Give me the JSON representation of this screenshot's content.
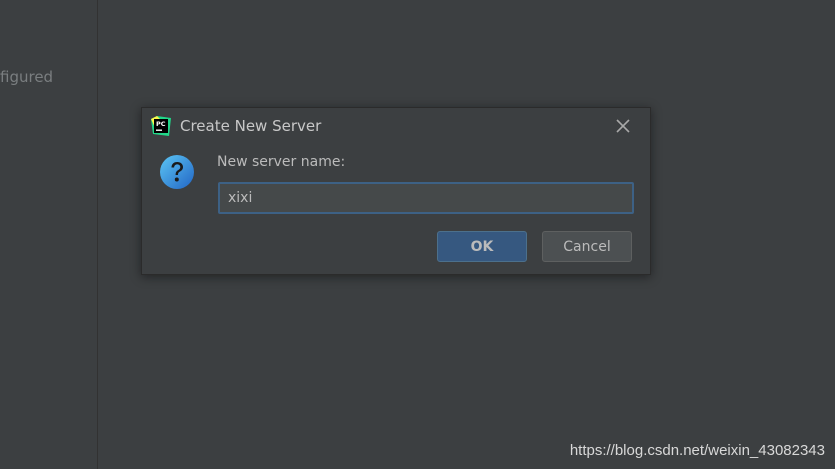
{
  "background_panel": {
    "partial_text": "figured"
  },
  "dialog": {
    "title": "Create New Server",
    "app_icon_letters": "PC",
    "field_label": "New server name:",
    "server_name_value": "xixi",
    "ok_label": "OK",
    "cancel_label": "Cancel",
    "icons": {
      "app": "pycharm-logo-icon",
      "close": "close-icon",
      "question": "question-icon"
    },
    "colors": {
      "ok_button": "#365880",
      "input_focus_border": "#3d6185",
      "question_icon": "#3a8fd6"
    }
  },
  "watermark": {
    "text": "https://blog.csdn.net/weixin_43082343"
  }
}
